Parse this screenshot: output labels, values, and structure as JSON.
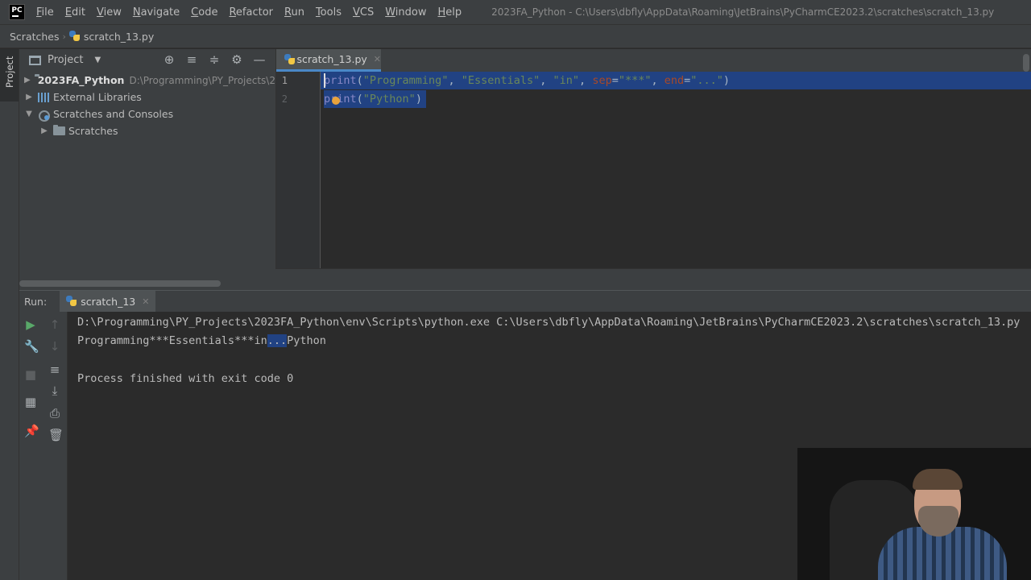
{
  "app": {
    "logo_text": "PC",
    "window_title": "2023FA_Python - C:\\Users\\dbfly\\AppData\\Roaming\\JetBrains\\PyCharmCE2023.2\\scratches\\scratch_13.py"
  },
  "menu": [
    {
      "first": "F",
      "rest": "ile"
    },
    {
      "first": "E",
      "rest": "dit"
    },
    {
      "first": "V",
      "rest": "iew"
    },
    {
      "first": "N",
      "rest": "avigate"
    },
    {
      "first": "C",
      "rest": "ode"
    },
    {
      "first": "R",
      "rest": "efactor"
    },
    {
      "first": "R",
      "rest": "un"
    },
    {
      "first": "T",
      "rest": "ools"
    },
    {
      "first": "V",
      "rest": "CS"
    },
    {
      "first": "W",
      "rest": "indow"
    },
    {
      "first": "H",
      "rest": "elp"
    }
  ],
  "breadcrumb": {
    "root": "Scratches",
    "file": "scratch_13.py"
  },
  "left_stripe": {
    "project_tab": "Project"
  },
  "project_panel": {
    "title": "Project",
    "tree": {
      "root_name": "2023FA_Python",
      "root_path": "D:\\Programming\\PY_Projects\\2",
      "external_libraries": "External Libraries",
      "scratches_consoles": "Scratches and Consoles",
      "scratches": "Scratches"
    }
  },
  "editor": {
    "tab_label": "scratch_13.py",
    "line_numbers": [
      "1",
      "2"
    ],
    "line1": {
      "fn": "print",
      "open": "(",
      "s1": "\"Programming\"",
      "c1": ", ",
      "s2": "\"Essentials\"",
      "c2": ", ",
      "s3": "\"in\"",
      "c3": ", ",
      "k1": "sep",
      "eq1": "=",
      "s4": "\"***\"",
      "c4": ", ",
      "k2": "end",
      "eq2": "=",
      "s5": "\"...\"",
      "close": ")"
    },
    "line2": {
      "fn": "print",
      "open": "(",
      "s1": "\"Python\"",
      "close": ")"
    }
  },
  "run_panel": {
    "label": "Run:",
    "tab_label": "scratch_13",
    "console": {
      "command": "D:\\Programming\\PY_Projects\\2023FA_Python\\env\\Scripts\\python.exe C:\\Users\\dbfly\\AppData\\Roaming\\JetBrains\\PyCharmCE2023.2\\scratches\\scratch_13.py",
      "out_a": "Programming***Essentials***in",
      "out_b": "...",
      "out_c": "Python",
      "exit": "Process finished with exit code 0"
    }
  },
  "colors": {
    "selection": "#214283",
    "string": "#6a8759",
    "keyword_arg": "#aa4926",
    "builtin": "#8888c6",
    "run_green": "#59a869"
  }
}
